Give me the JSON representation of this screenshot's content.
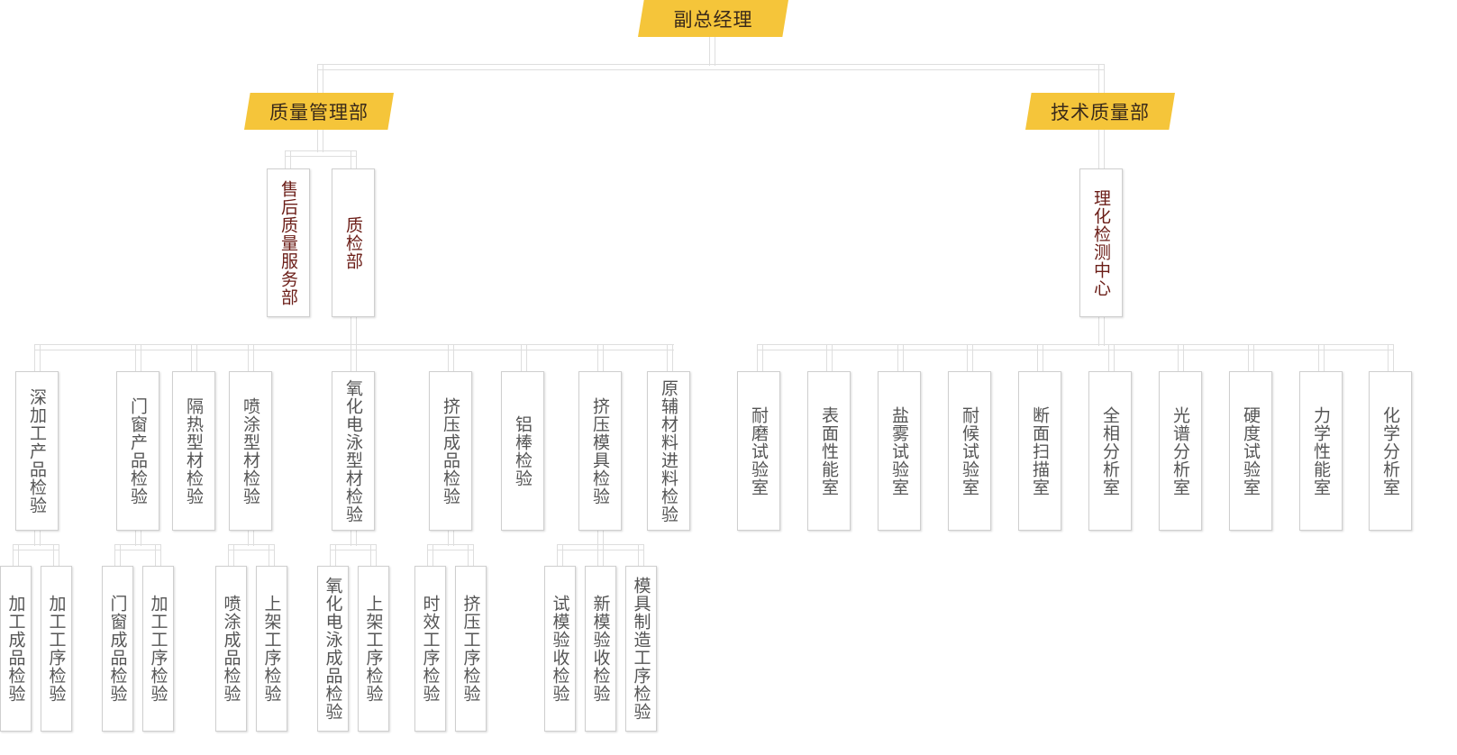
{
  "root": "副总经理",
  "departments": {
    "quality": "质量管理部",
    "tech": "技术质量部"
  },
  "level2": {
    "after_sales": "售后质量服务部",
    "inspection": "质检部",
    "lab": "理化检测中心"
  },
  "inspection_units": [
    "深加工产品检验",
    "门窗产品检验",
    "隔热型材检验",
    "喷涂型材检验",
    "氧化电泳型材检验",
    "挤压成品检验",
    "铝棒检验",
    "挤压模具检验",
    "原辅材料进料检验"
  ],
  "lab_rooms": [
    "耐磨试验室",
    "表面性能室",
    "盐雾试验室",
    "耐候试验室",
    "断面扫描室",
    "全相分析室",
    "光谱分析室",
    "硬度试验室",
    "力学性能室",
    "化学分析室"
  ],
  "sub_units": [
    "加工成品检验",
    "加工工序检验",
    "门窗成品检验",
    "加工工序检验",
    "喷涂成品检验",
    "上架工序检验",
    "氧化电泳成品检验",
    "上架工序检验",
    "时效工序检验",
    "挤压工序检验",
    "试模验收检验",
    "新模验收检验",
    "模具制造工序检验"
  ],
  "colors": {
    "accent": "#f5c53a",
    "connector": "#dedede",
    "dept_text": "#6b1d17",
    "unit_text": "#555555"
  }
}
